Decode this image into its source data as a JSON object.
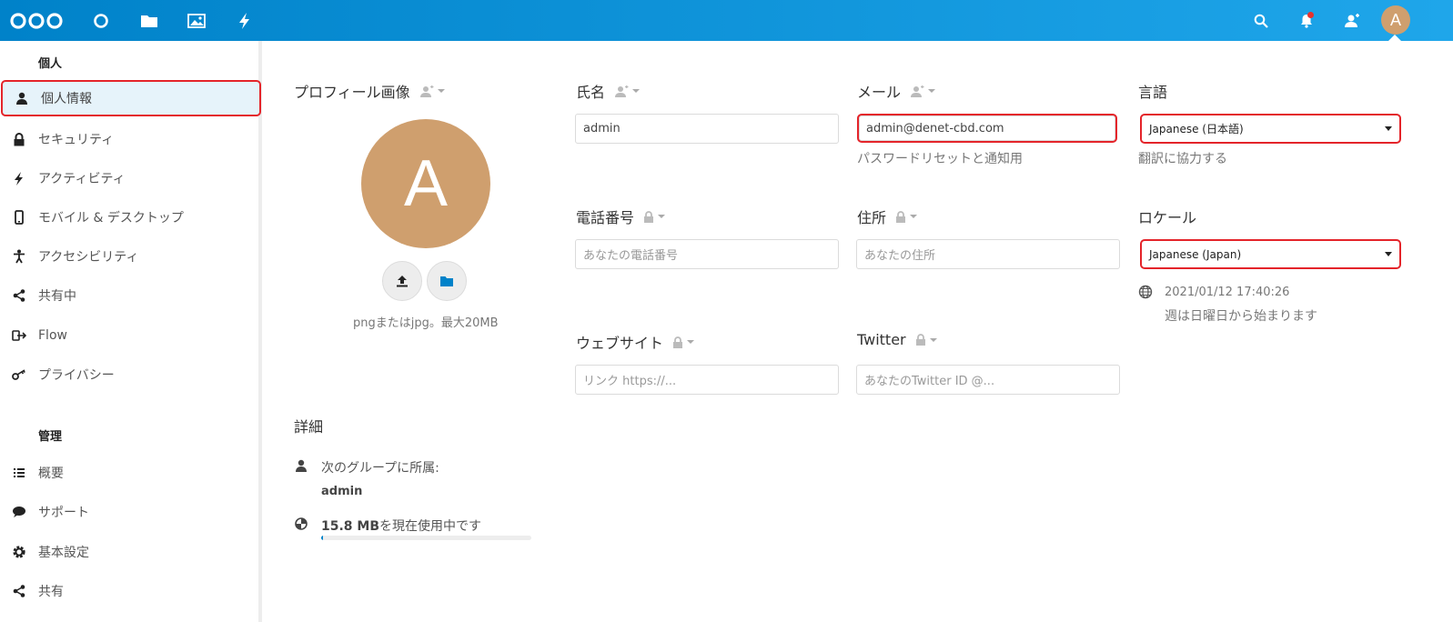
{
  "header": {
    "apps": [
      "logo-icon",
      "dashboard-icon",
      "files-icon",
      "photos-icon",
      "activity-icon"
    ],
    "user_initial": "A"
  },
  "sidebar": {
    "personal_title": "個人",
    "admin_title": "管理",
    "personal_items": [
      {
        "label": "個人情報",
        "icon": "person-icon"
      },
      {
        "label": "セキュリティ",
        "icon": "lock-icon"
      },
      {
        "label": "アクティビティ",
        "icon": "activity-icon"
      },
      {
        "label": "モバイル & デスクトップ",
        "icon": "phone-icon"
      },
      {
        "label": "アクセシビリティ",
        "icon": "accessibility-icon"
      },
      {
        "label": "共有中",
        "icon": "share-icon"
      },
      {
        "label": "Flow",
        "icon": "flow-icon"
      },
      {
        "label": "プライバシー",
        "icon": "key-icon"
      }
    ],
    "admin_items": [
      {
        "label": "概要",
        "icon": "overview-icon"
      },
      {
        "label": "サポート",
        "icon": "support-icon"
      },
      {
        "label": "基本設定",
        "icon": "gear-icon"
      },
      {
        "label": "共有",
        "icon": "share-icon"
      }
    ]
  },
  "profile": {
    "title": "プロフィール画像",
    "initial": "A",
    "hint": "pngまたはjpg。最大20MB"
  },
  "fields": {
    "name": {
      "label": "氏名",
      "value": "admin"
    },
    "email": {
      "label": "メール",
      "value": "admin@denet-cbd.com",
      "hint": "パスワードリセットと通知用"
    },
    "language": {
      "label": "言語",
      "value": "Japanese (日本語)",
      "hint": "翻訳に協力する"
    },
    "phone": {
      "label": "電話番号",
      "placeholder": "あなたの電話番号"
    },
    "address": {
      "label": "住所",
      "placeholder": "あなたの住所"
    },
    "locale": {
      "label": "ロケール",
      "value": "Japanese (Japan)",
      "datetime": "2021/01/12 17:40:26",
      "week": "週は日曜日から始まります"
    },
    "website": {
      "label": "ウェブサイト",
      "placeholder": "リンク https://..."
    },
    "twitter": {
      "label": "Twitter",
      "placeholder": "あなたのTwitter ID @..."
    }
  },
  "details": {
    "title": "詳細",
    "groups_label": "次のグループに所属:",
    "group": "admin",
    "usage_amount": "15.8 MB",
    "usage_suffix": "を現在使用中です",
    "usage_fraction": 0.01
  },
  "colors": {
    "header": "#0082c9",
    "avatar": "#cf9f6e",
    "highlight": "#e4242a"
  }
}
